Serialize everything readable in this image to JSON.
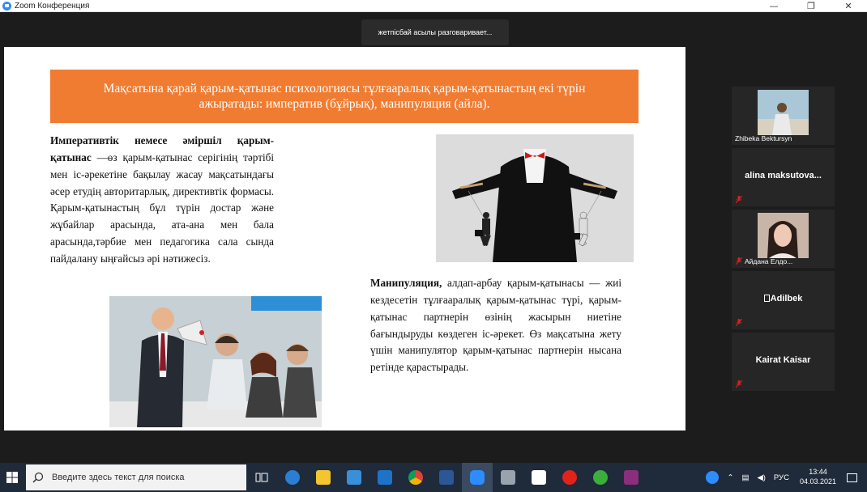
{
  "window": {
    "title": "Zoom Конференция",
    "minimize_glyph": "—",
    "restore_glyph": "❐",
    "close_glyph": "✕"
  },
  "banner": {
    "speaking": "жетпісбай асылы разговаривает..."
  },
  "slide": {
    "header": "Мақсатына қарай қарым-қатынас психологиясы тұлғааралық қарым-қатынастың екі түрін ажыратады: императив (бұйрық), манипуляция (айла).",
    "left_bold": "Императивтік немесе әміршіл қарым-қатынас",
    "left_body": " —өз қарым-қатынас серігінің тәртібі мен іс-әрекетіне бақылау жасау мақсатындағы әсер етудің авторитарлық, директивтік формасы. Қарым-қатынастың бұл түрін достар және жұбайлар арасында, ата-ана мен бала арасында,тәрбие мен педагогика сала сында пайдалану ыңғайсыз әрі нәтижесіз.",
    "right_bold": "Манипуляция,",
    "right_body": " алдап-арбау қарым-қатынасы — жиі кездесетін тұлғааралық қарым-қатынас түрі, қарым-қатынас партнерін өзінің жасырын ниетіне бағындыруды көздеген іс-әрекет. Өз мақсатына жету үшін манипулятор қарым-қатынас партнерін нысана ретінде қарастырады."
  },
  "participants": [
    {
      "name": "Zhibeka Bektursyn",
      "has_photo": true
    },
    {
      "name": "alina  maksutova...",
      "has_photo": false
    },
    {
      "name": "Айдана Елдо...",
      "has_photo": true
    },
    {
      "name": "Adilbek",
      "has_photo": false
    },
    {
      "name": "Kairat Kaisar",
      "has_photo": false
    }
  ],
  "taskbar": {
    "search_placeholder": "Введите здесь текст для поиска",
    "language": "РУС",
    "time": "13:44",
    "date": "04.03.2021"
  },
  "colors": {
    "slide_header_bg": "#f07c32",
    "taskbar_bg": "#1f2a3a",
    "meeting_bg": "#1c1c1c",
    "tile_bg": "#262626",
    "mic_muted": "#e02020"
  }
}
